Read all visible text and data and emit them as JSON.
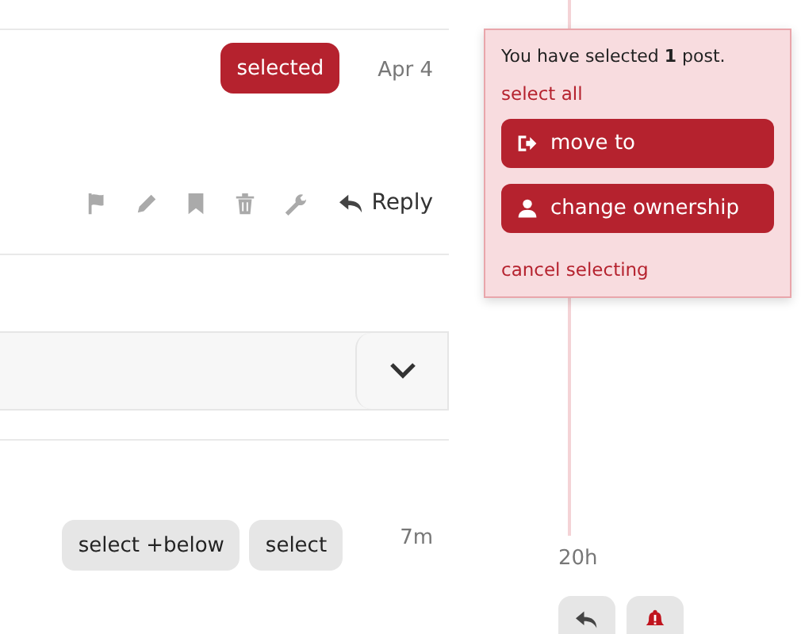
{
  "posts": [
    {
      "date": "Apr 4",
      "select_buttons": [
        {
          "label": "selected",
          "selected": true
        }
      ],
      "actions": [
        {
          "kind": "flag"
        },
        {
          "kind": "edit"
        },
        {
          "kind": "bookmark"
        },
        {
          "kind": "delete"
        },
        {
          "kind": "admin"
        }
      ],
      "reply_label": "Reply"
    },
    {
      "date": "7m",
      "select_buttons": [
        {
          "label": "select +below",
          "selected": false
        },
        {
          "label": "select",
          "selected": false
        }
      ]
    }
  ],
  "selection_panel": {
    "message": "You have selected **1** post.",
    "select_all": "select all",
    "buttons": [
      {
        "kind": "move",
        "label": "move to"
      },
      {
        "kind": "owner",
        "label": "change ownership"
      }
    ],
    "cancel": "cancel selecting"
  },
  "timeline": {
    "date": "20h"
  }
}
